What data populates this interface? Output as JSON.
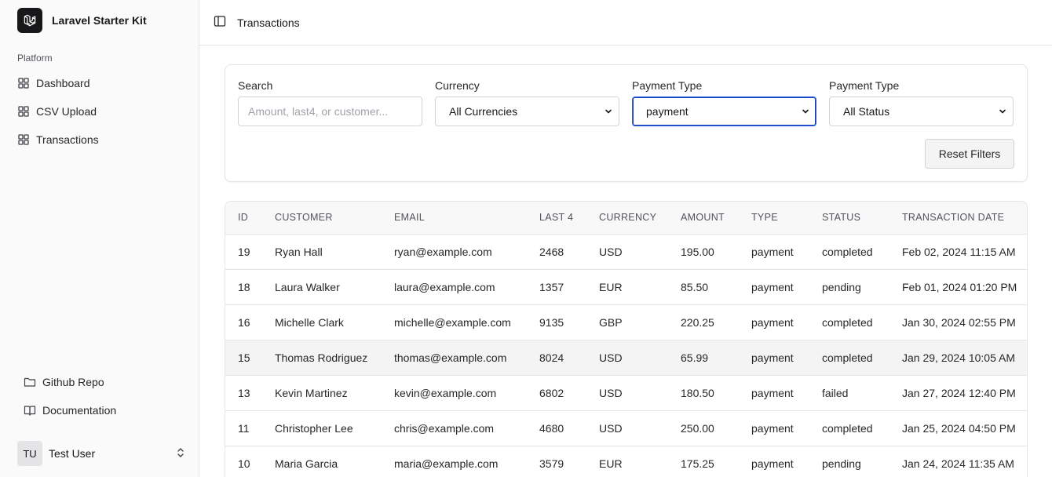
{
  "sidebar": {
    "brand": "Laravel Starter Kit",
    "section_label": "Platform",
    "nav": [
      {
        "label": "Dashboard",
        "icon": "layout-grid-icon"
      },
      {
        "label": "CSV Upload",
        "icon": "layout-grid-icon"
      },
      {
        "label": "Transactions",
        "icon": "layout-grid-icon"
      }
    ],
    "bottom_nav": [
      {
        "label": "Github Repo",
        "icon": "folder-icon"
      },
      {
        "label": "Documentation",
        "icon": "book-open-icon"
      }
    ],
    "user": {
      "initials": "TU",
      "name": "Test User"
    }
  },
  "header": {
    "title": "Transactions"
  },
  "filters": {
    "search": {
      "label": "Search",
      "placeholder": "Amount, last4, or customer..."
    },
    "currency": {
      "label": "Currency",
      "value": "All Currencies"
    },
    "payment_type": {
      "label": "Payment Type",
      "value": "payment"
    },
    "status": {
      "label": "Payment Type",
      "value": "All Status"
    },
    "reset_label": "Reset Filters"
  },
  "table": {
    "headers": [
      "ID",
      "CUSTOMER",
      "EMAIL",
      "LAST 4",
      "CURRENCY",
      "AMOUNT",
      "TYPE",
      "STATUS",
      "TRANSACTION DATE"
    ],
    "rows": [
      [
        "19",
        "Ryan Hall",
        "ryan@example.com",
        "2468",
        "USD",
        "195.00",
        "payment",
        "completed",
        "Feb 02, 2024 11:15 AM"
      ],
      [
        "18",
        "Laura Walker",
        "laura@example.com",
        "1357",
        "EUR",
        "85.50",
        "payment",
        "pending",
        "Feb 01, 2024 01:20 PM"
      ],
      [
        "16",
        "Michelle Clark",
        "michelle@example.com",
        "9135",
        "GBP",
        "220.25",
        "payment",
        "completed",
        "Jan 30, 2024 02:55 PM"
      ],
      [
        "15",
        "Thomas Rodriguez",
        "thomas@example.com",
        "8024",
        "USD",
        "65.99",
        "payment",
        "completed",
        "Jan 29, 2024 10:05 AM"
      ],
      [
        "13",
        "Kevin Martinez",
        "kevin@example.com",
        "6802",
        "USD",
        "180.50",
        "payment",
        "failed",
        "Jan 27, 2024 12:40 PM"
      ],
      [
        "11",
        "Christopher Lee",
        "chris@example.com",
        "4680",
        "USD",
        "250.00",
        "payment",
        "completed",
        "Jan 25, 2024 04:50 PM"
      ],
      [
        "10",
        "Maria Garcia",
        "maria@example.com",
        "3579",
        "EUR",
        "175.25",
        "payment",
        "pending",
        "Jan 24, 2024 11:35 AM"
      ]
    ]
  },
  "colors": {
    "accent": "#2563eb",
    "sidebar_bg": "#fafafa",
    "border": "#e4e4e7",
    "highlight_row": "#f4f4f5"
  }
}
